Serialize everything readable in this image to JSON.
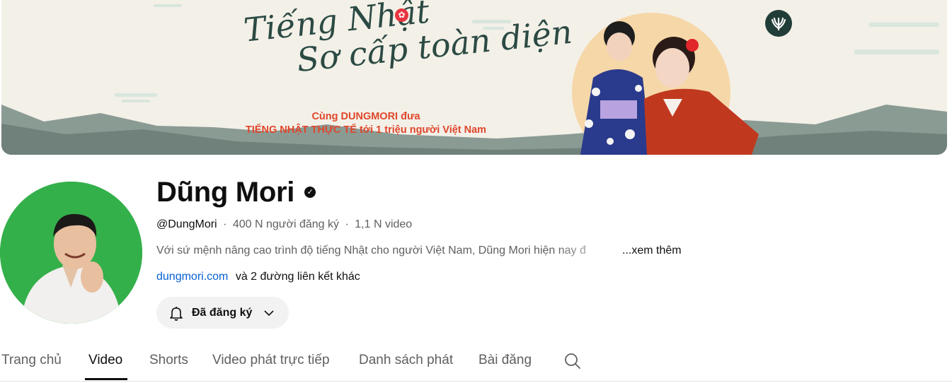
{
  "banner": {
    "title_line1": "Tiếng Nhật",
    "title_line2": "Sơ cấp toàn diện",
    "tagline_line1": "Cùng DUNGMORI đưa",
    "tagline_line2": "TIẾNG NHẬT THỰC TẾ tới 1 triệu người Việt Nam"
  },
  "channel": {
    "name": "Dũng Mori",
    "verified_mark": "✓",
    "handle": "@DungMori",
    "separator": "·",
    "subscribers": "400 N người đăng ký",
    "videos": "1,1 N video",
    "description": "Với sứ mệnh nâng cao trình độ tiếng Nhật cho người Việt Nam, Dũng Mori hiện nay đ",
    "more_label": "...xem thêm",
    "link_text": "dungmori.com",
    "extra_links": "và 2 đường liên kết khác"
  },
  "subscribe": {
    "label": "Đã đăng ký",
    "bell_icon": "bell-icon",
    "chevron_icon": "chevron-down-icon"
  },
  "tabs": [
    {
      "label": "Trang chủ"
    },
    {
      "label": "Video",
      "active": true
    },
    {
      "label": "Shorts"
    },
    {
      "label": "Video phát trực tiếp"
    },
    {
      "label": "Danh sách phát"
    },
    {
      "label": "Bài đăng"
    }
  ],
  "colors": {
    "banner_text": "#2b4a43",
    "tagline": "#e0462b",
    "link": "#065fd4",
    "avatar_bg": "#34b04a"
  }
}
